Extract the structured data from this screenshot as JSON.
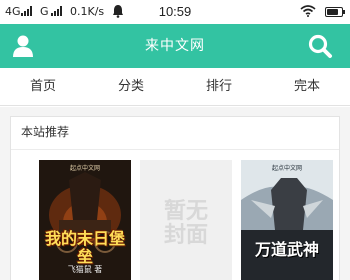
{
  "status_bar": {
    "net1": "4G",
    "net2": "G",
    "speed": "0.1K/s",
    "time": "10:59",
    "battery_level": 0.8
  },
  "header": {
    "title": "来中文网",
    "user_icon": "user-icon",
    "search_icon": "search-icon",
    "accent_color": "#33c3a2"
  },
  "nav": {
    "items": [
      "首页",
      "分类",
      "排行",
      "完本"
    ]
  },
  "recommend": {
    "title": "本站推荐",
    "books": [
      {
        "cover_title": "我的末日堡垒",
        "publisher": "起点中文网",
        "author": "飞猫鼠 著"
      },
      {
        "placeholder_line1": "暂无",
        "placeholder_line2": "封面"
      },
      {
        "cover_title": "万道武神",
        "publisher": "起点中文网"
      }
    ]
  }
}
